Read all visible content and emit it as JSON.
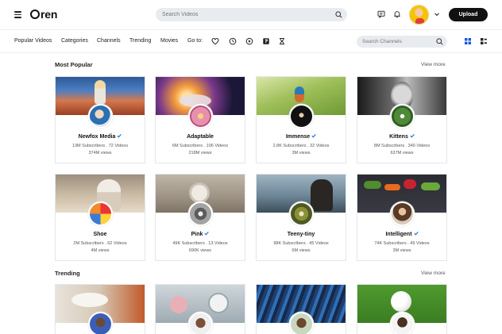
{
  "header": {
    "logo_text": "ren",
    "search_placeholder": "Search Videos",
    "upload_label": "Upload",
    "icons": [
      "menu-icon",
      "message-icon",
      "bell-icon",
      "chevron-down-icon"
    ]
  },
  "nav": {
    "items": [
      "Popular Videos",
      "Categories",
      "Channels",
      "Trending",
      "Movies"
    ],
    "goto_label": "Go to:",
    "goto_icons": [
      "heart-icon",
      "clock-icon",
      "play-icon",
      "film-icon",
      "hourglass-icon"
    ],
    "channel_search_placeholder": "Search Channels"
  },
  "popular": {
    "title": "Most Popular",
    "view_more": "View more",
    "cards": [
      {
        "name": "Newfox Media",
        "verified": true,
        "subs": "13M Subscribers . 72 Videos",
        "views": "374M views"
      },
      {
        "name": "Adaptable",
        "verified": false,
        "subs": "6M Subscribers . 106 Videos",
        "views": "218M views"
      },
      {
        "name": "Immense",
        "verified": true,
        "subs": "2.8K Subscribers . 32 Videos",
        "views": "3M views"
      },
      {
        "name": "Kittens",
        "verified": true,
        "subs": "8M Subscribers . 340 Videos",
        "views": "637M views"
      },
      {
        "name": "Shoe",
        "verified": false,
        "subs": "2M Subscribers . 62 Videos",
        "views": "4M views"
      },
      {
        "name": "Pink",
        "verified": true,
        "subs": "49K Subscribers . 13 Videos",
        "views": "690K views"
      },
      {
        "name": "Teeny-tiny",
        "verified": false,
        "subs": "98K Subscribers . 45 Videos",
        "views": "6M views"
      },
      {
        "name": "Intelligent",
        "verified": true,
        "subs": "74K Subscribers . 49 Videos",
        "views": "3M views"
      }
    ]
  },
  "trending": {
    "title": "Trending",
    "view_more": "View more"
  },
  "colors": {
    "accent_verified": "#1a73e8",
    "search_bg": "#e8ebf0",
    "upload_bg": "#111111"
  }
}
